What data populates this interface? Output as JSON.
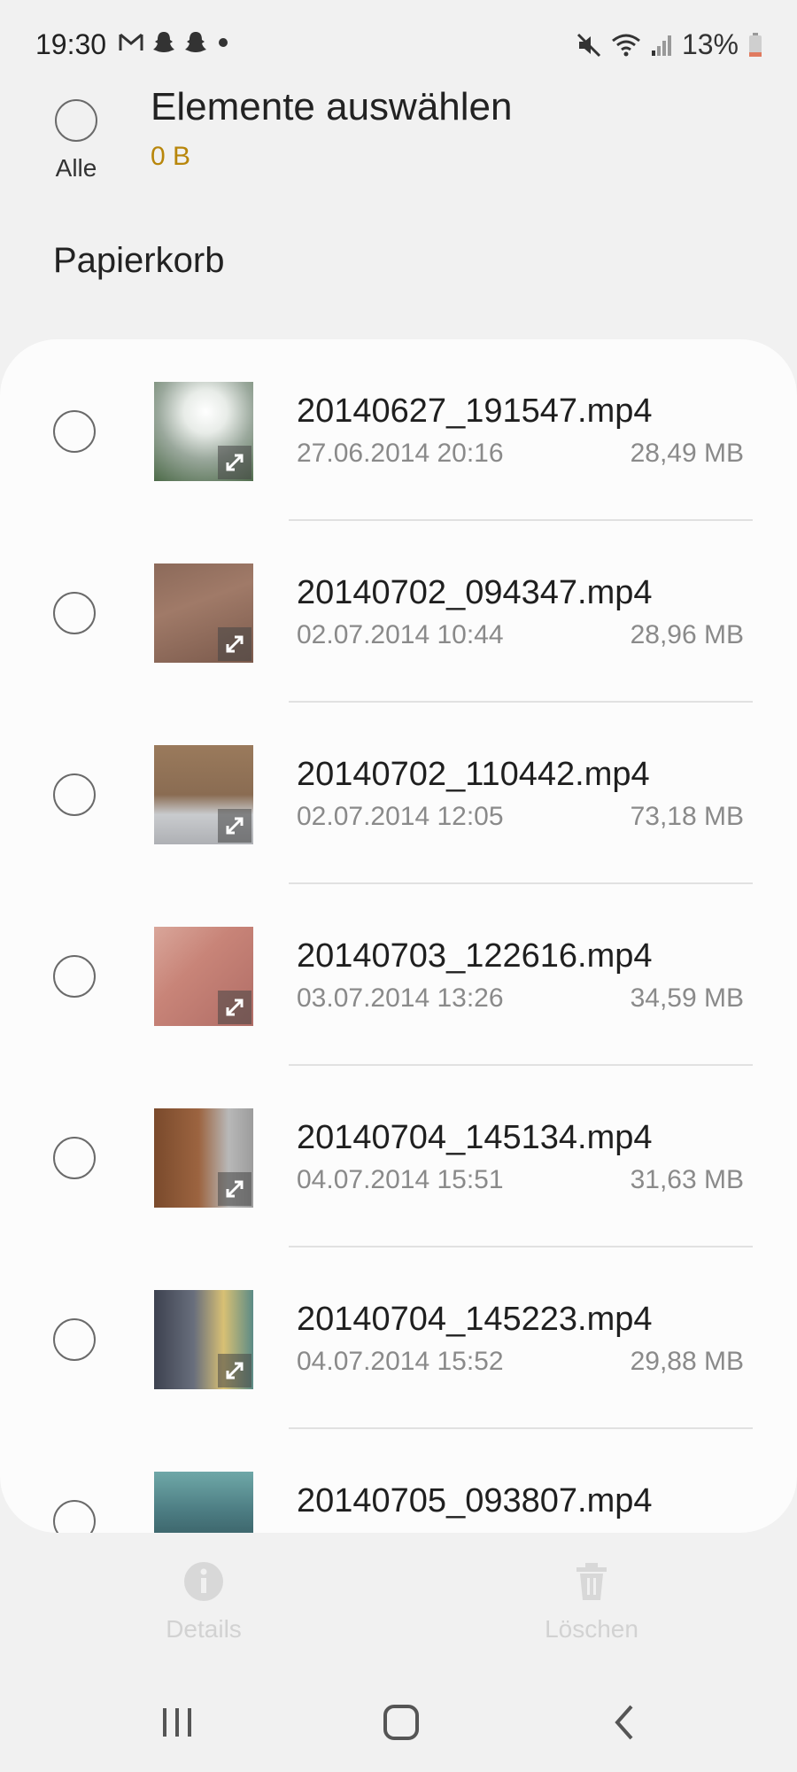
{
  "status_bar": {
    "time": "19:30",
    "battery": "13%"
  },
  "header": {
    "select_all_label": "Alle",
    "title": "Elemente auswählen",
    "selected_size": "0 B"
  },
  "section": {
    "title": "Papierkorb"
  },
  "files": [
    {
      "name": "20140627_191547.mp4",
      "date": "27.06.2014 20:16",
      "size": "28,49 MB"
    },
    {
      "name": "20140702_094347.mp4",
      "date": "02.07.2014 10:44",
      "size": "28,96 MB"
    },
    {
      "name": "20140702_110442.mp4",
      "date": "02.07.2014 12:05",
      "size": "73,18 MB"
    },
    {
      "name": "20140703_122616.mp4",
      "date": "03.07.2014 13:26",
      "size": "34,59 MB"
    },
    {
      "name": "20140704_145134.mp4",
      "date": "04.07.2014 15:51",
      "size": "31,63 MB"
    },
    {
      "name": "20140704_145223.mp4",
      "date": "04.07.2014 15:52",
      "size": "29,88 MB"
    },
    {
      "name": "20140705_093807.mp4",
      "date": "",
      "size": ""
    }
  ],
  "actions": {
    "details_label": "Details",
    "delete_label": "Löschen"
  },
  "colors": {
    "accent": "#b8860b",
    "background": "#f1f1f1",
    "card": "#fcfcfc"
  }
}
